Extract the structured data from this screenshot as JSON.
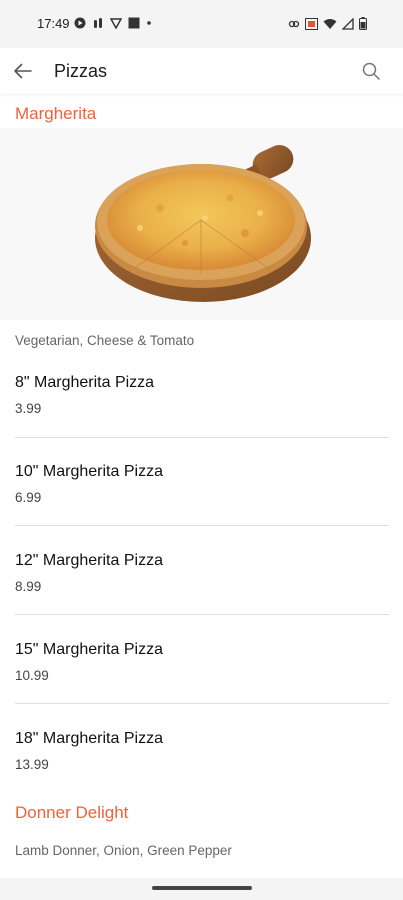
{
  "status_bar": {
    "time": "17:49"
  },
  "header": {
    "title": "Pizzas"
  },
  "sections": [
    {
      "title": "Margherita",
      "description": "Vegetarian, Cheese & Tomato",
      "items": [
        {
          "name": "8\" Margherita Pizza",
          "price": "3.99"
        },
        {
          "name": "10\" Margherita Pizza",
          "price": "6.99"
        },
        {
          "name": "12\" Margherita Pizza",
          "price": "8.99"
        },
        {
          "name": "15\" Margherita Pizza",
          "price": "10.99"
        },
        {
          "name": "18\" Margherita Pizza",
          "price": "13.99"
        }
      ]
    },
    {
      "title": "Donner Delight",
      "description": "Lamb Donner, Onion, Green Pepper"
    }
  ],
  "colors": {
    "accent": "#f0623a",
    "divider": "#dedede",
    "status_bar_bg": "#f4f4f4"
  }
}
